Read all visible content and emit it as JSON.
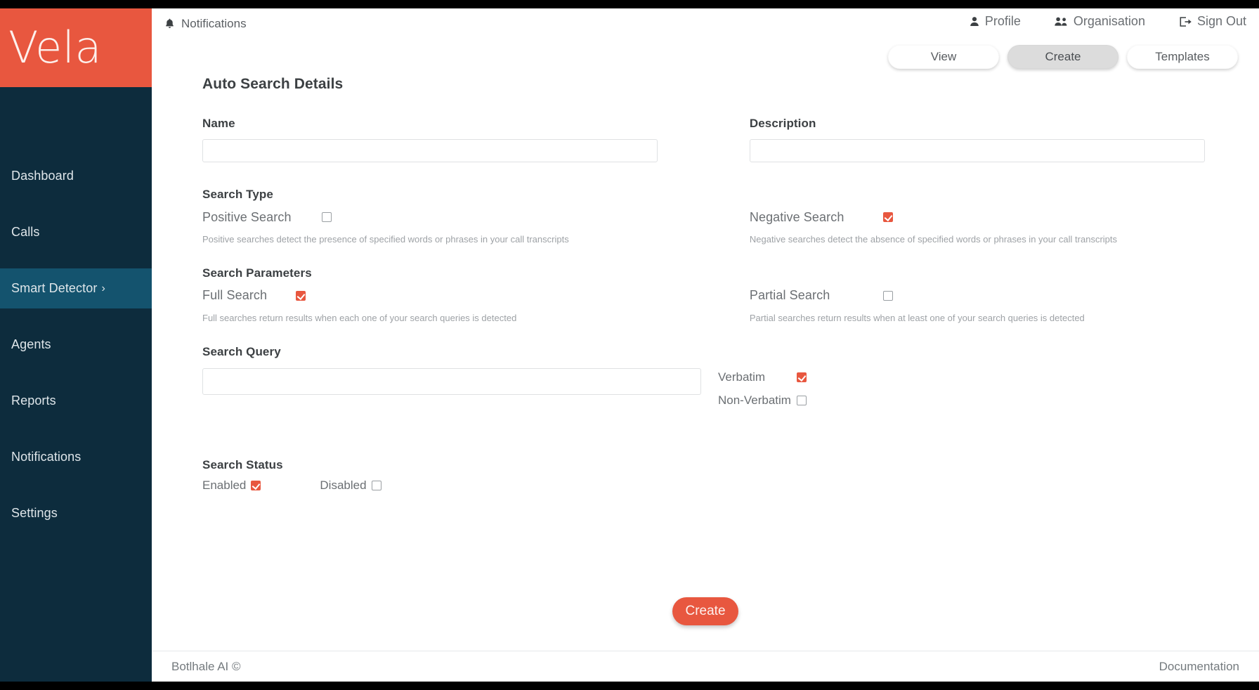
{
  "brand": {
    "logo_text": "Vela",
    "logo_bg": "#e8573f",
    "sidebar_bg": "#0d2c3d",
    "accent": "#e8573f",
    "active_nav_bg": "#14536e"
  },
  "sidebar": {
    "items": [
      {
        "label": "Dashboard",
        "active": false,
        "chevron": ""
      },
      {
        "label": "Calls",
        "active": false,
        "chevron": ""
      },
      {
        "label": "Smart Detector",
        "active": true,
        "chevron": "›"
      },
      {
        "label": "Agents",
        "active": false,
        "chevron": ""
      },
      {
        "label": "Reports",
        "active": false,
        "chevron": ""
      },
      {
        "label": "Notifications",
        "active": false,
        "chevron": ""
      },
      {
        "label": "Settings",
        "active": false,
        "chevron": ""
      }
    ]
  },
  "topbar": {
    "notifications_label": "Notifications",
    "notifications_icon": "bell-icon",
    "profile_label": "Profile",
    "profile_icon": "person-icon",
    "organisation_label": "Organisation",
    "organisation_icon": "people-icon",
    "signout_label": "Sign Out",
    "signout_icon": "sign-out-icon"
  },
  "tabs": [
    {
      "label": "View",
      "active": false
    },
    {
      "label": "Create",
      "active": true
    },
    {
      "label": "Templates",
      "active": false
    }
  ],
  "form": {
    "title": "Auto Search Details",
    "name": {
      "label": "Name",
      "value": "",
      "placeholder": ""
    },
    "description": {
      "label": "Description",
      "value": "",
      "placeholder": ""
    },
    "search_type": {
      "heading": "Search Type",
      "positive": {
        "label": "Positive Search",
        "checked": false,
        "help": "Positive searches detect the presence of specified words or phrases in your call transcripts"
      },
      "negative": {
        "label": "Negative Search",
        "checked": true,
        "help": "Negative searches detect the absence of specified words or phrases in your call transcripts"
      }
    },
    "search_parameters": {
      "heading": "Search Parameters",
      "full": {
        "label": "Full Search",
        "checked": true,
        "help": "Full searches return results when each one of your search queries is detected"
      },
      "partial": {
        "label": "Partial Search",
        "checked": false,
        "help": "Partial searches return results when at least one of your search queries is detected"
      }
    },
    "search_query": {
      "heading": "Search Query",
      "value": "",
      "placeholder": "",
      "verbatim": {
        "label": "Verbatim",
        "checked": true
      },
      "non_verbatim": {
        "label": "Non-Verbatim",
        "checked": false
      }
    },
    "search_status": {
      "heading": "Search Status",
      "enabled": {
        "label": "Enabled",
        "checked": true
      },
      "disabled": {
        "label": "Disabled",
        "checked": false
      }
    },
    "submit_label": "Create"
  },
  "footer": {
    "copyright": "Botlhale AI ©",
    "documentation_label": "Documentation"
  }
}
